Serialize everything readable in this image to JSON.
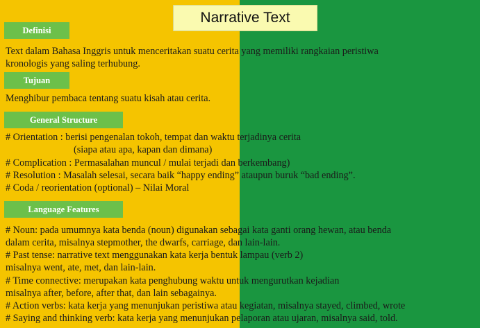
{
  "title": "Narrative Text",
  "colors": {
    "left_panel": "#f5c400",
    "right_panel": "#1a9640",
    "label_bg": "#6cc04a",
    "title_bg": "#fafab0"
  },
  "sections": {
    "definisi": {
      "label": "Definisi",
      "lines": [
        "Text dalam Bahasa Inggris untuk menceritakan suatu cerita yang memiliki rangkaian peristiwa",
        "kronologis yang saling terhubung."
      ]
    },
    "tujuan": {
      "label": "Tujuan",
      "lines": [
        "Menghibur pembaca tentang suatu kisah atau cerita."
      ]
    },
    "general_structure": {
      "label": "General Structure",
      "lines": [
        "# Orientation : berisi pengenalan tokoh, tempat dan waktu terjadinya cerita",
        "(siapa atau apa, kapan dan dimana)",
        "# Complication : Permasalahan muncul / mulai terjadi dan berkembang)",
        "# Resolution : Masalah selesai, secara baik “happy ending” ataupun buruk “bad ending”.",
        "# Coda / reorientation (optional) – Nilai Moral"
      ]
    },
    "language_features": {
      "label": "Language Features",
      "lines": [
        "# Noun: pada umumnya kata benda (noun) digunakan sebagai kata ganti orang hewan, atau benda",
        "dalam cerita, misalnya stepmother, the dwarfs, carriage, dan lain-lain.",
        "# Past tense: narrative text menggunakan kata kerja bentuk lampau (verb 2)",
        "misalnya went, ate, met, dan lain-lain.",
        "# Time connective: merupakan kata penghubung waktu untuk mengurutkan kejadian",
        "misalnya after, before, after that, dan lain sebagainya.",
        "# Action verbs: kata kerja yang menunjukan peristiwa atau kegiatan, misalnya stayed, climbed, wrote",
        "# Saying and thinking verb: kata kerja yang menunjukan pelaporan atau ujaran, misalnya said, told."
      ]
    }
  }
}
